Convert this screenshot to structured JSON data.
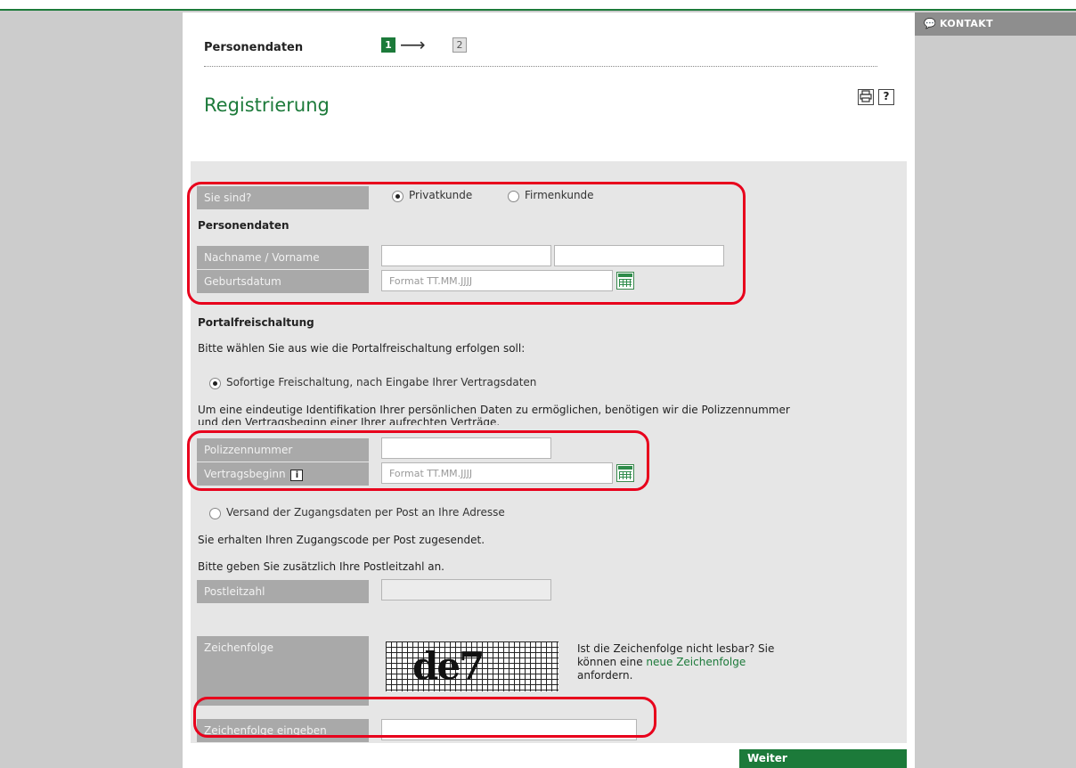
{
  "sidebar_right": {
    "kontakt_label": "KONTAKT",
    "kontakt_icon": "speech-bubble-icon"
  },
  "steps": {
    "title": "Personendaten",
    "step1": "1",
    "arrow": "⟶",
    "step2": "2"
  },
  "page": {
    "title": "Registrierung",
    "print_icon": "printer-icon",
    "help_label": "?"
  },
  "form": {
    "customer_type_label": "Sie sind?",
    "customer_type_options": [
      {
        "label": "Privatkunde",
        "checked": true
      },
      {
        "label": "Firmenkunde",
        "checked": false
      }
    ],
    "personal_section_title": "Personendaten",
    "name_label": "Nachname / Vorname",
    "lastname_value": "",
    "firstname_value": "",
    "birthdate_label": "Geburtsdatum",
    "birthdate_placeholder": "Format TT.MM.JJJJ",
    "portal_section_title": "Portalfreischaltung",
    "portal_intro": "Bitte wählen Sie aus wie die Portalfreischaltung erfolgen soll:",
    "option_instant": {
      "label": "Sofortige Freischaltung, nach Eingabe Ihrer Vertragsdaten",
      "checked": true
    },
    "instant_info_line1": "Um eine eindeutige Identifikation Ihrer persönlichen Daten zu ermöglichen, benötigen wir die Polizzennummer",
    "instant_info_line2": "und den Vertragsbeginn einer Ihrer aufrechten Verträge.",
    "policy_label": "Polizzennummer",
    "policy_value": "",
    "contract_start_label": "Vertragsbeginn",
    "contract_start_info": "i",
    "contract_start_placeholder": "Format TT.MM.JJJJ",
    "option_post": {
      "label": "Versand der Zugangsdaten per Post an Ihre Adresse",
      "checked": false
    },
    "post_info": "Sie erhalten Ihren Zugangscode per Post zugesendet.",
    "postal_intro": "Bitte geben Sie zusätzlich Ihre Postleitzahl an.",
    "postal_label": "Postleitzahl",
    "postal_value": "",
    "captcha_label": "Zeichenfolge",
    "captcha_text": "de7",
    "captcha_help_1": "Ist die Zeichenfolge nicht lesbar? Sie",
    "captcha_help_2a": "können eine ",
    "captcha_help_link": "neue Zeichenfolge",
    "captcha_help_3": "anfordern.",
    "captcha_input_label": "Zeichenfolge eingeben",
    "captcha_input_value": ""
  },
  "actions": {
    "next_label": "Weiter"
  },
  "colors": {
    "brand_green": "#1c7a3a",
    "highlight_red": "#e8001c",
    "label_gray": "#a9a9a9",
    "panel_gray": "#e6e6e6"
  }
}
